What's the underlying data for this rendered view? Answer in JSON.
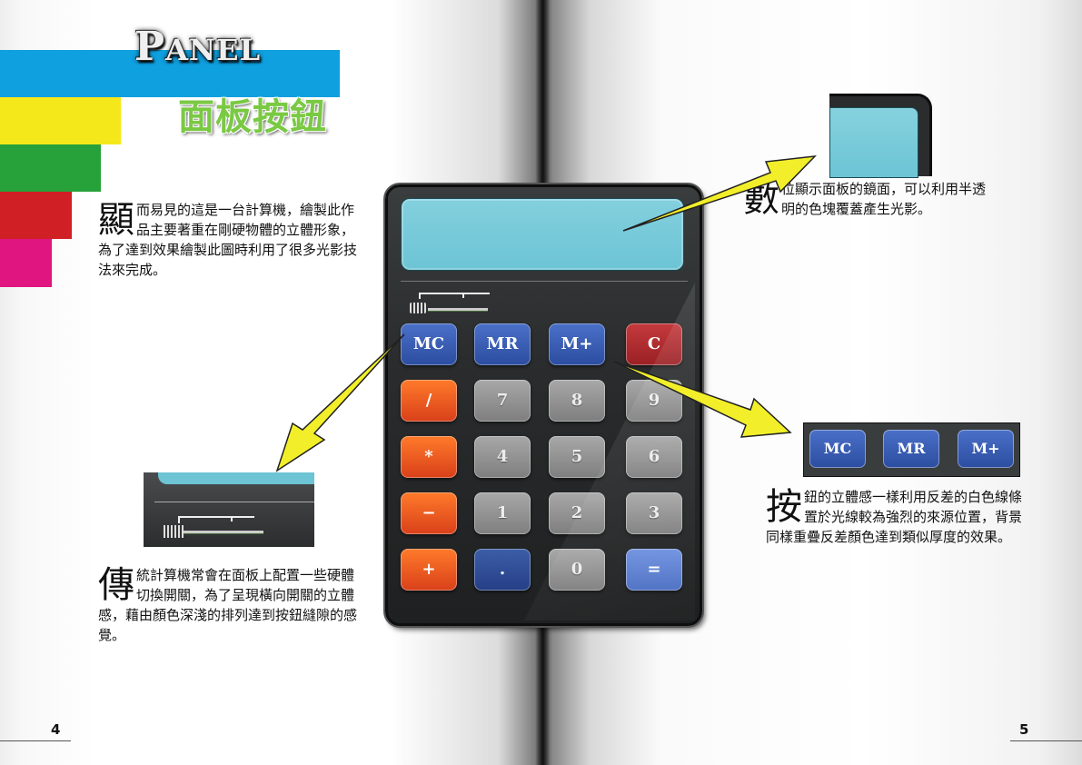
{
  "header": {
    "title_en_first": "P",
    "title_en_rest": "ANEL",
    "title_zh": "面板按鈕"
  },
  "paragraphs": {
    "p1": {
      "dropcap": "顯",
      "text": "而易見的這是一台計算機，繪製此作品主要著重在剛硬物體的立體形象，為了達到效果繪製此圖時利用了很多光影技法來完成。"
    },
    "p2": {
      "dropcap": "傳",
      "text": "統計算機常會在面板上配置一些硬體切換開關，為了呈現橫向開關的立體感，藉由顏色深淺的排列達到按鈕縫隙的感覺。"
    },
    "p3": {
      "dropcap": "數",
      "text": "位顯示面板的鏡面，可以利用半透明的色塊覆蓋產生光影。"
    },
    "p4": {
      "dropcap": "按",
      "text": "鈕的立體感一樣利用反差的白色線條置於光線較為強烈的來源位置，背景同樣重疊反差顏色達到類似厚度的效果。"
    }
  },
  "calculator": {
    "keys": [
      [
        "MC",
        "MR",
        "M+",
        "C"
      ],
      [
        "/",
        "7",
        "8",
        "9"
      ],
      [
        "*",
        "4",
        "5",
        "6"
      ],
      [
        "−",
        "1",
        "2",
        "3"
      ],
      [
        "+",
        ".",
        "0",
        "="
      ]
    ]
  },
  "inset_keys": [
    "MC",
    "MR",
    "M+"
  ],
  "page_numbers": {
    "left": "4",
    "right": "5"
  },
  "colors": {
    "bar_blue": "#0fa0e0",
    "bar_yellow": "#f5e81a",
    "bar_green": "#27a13a",
    "bar_red": "#d11f26",
    "bar_magenta": "#e0157f",
    "title_zh": "#7ac943",
    "display": "#6cc4d4",
    "arrow_fill": "#f2ef2a"
  }
}
